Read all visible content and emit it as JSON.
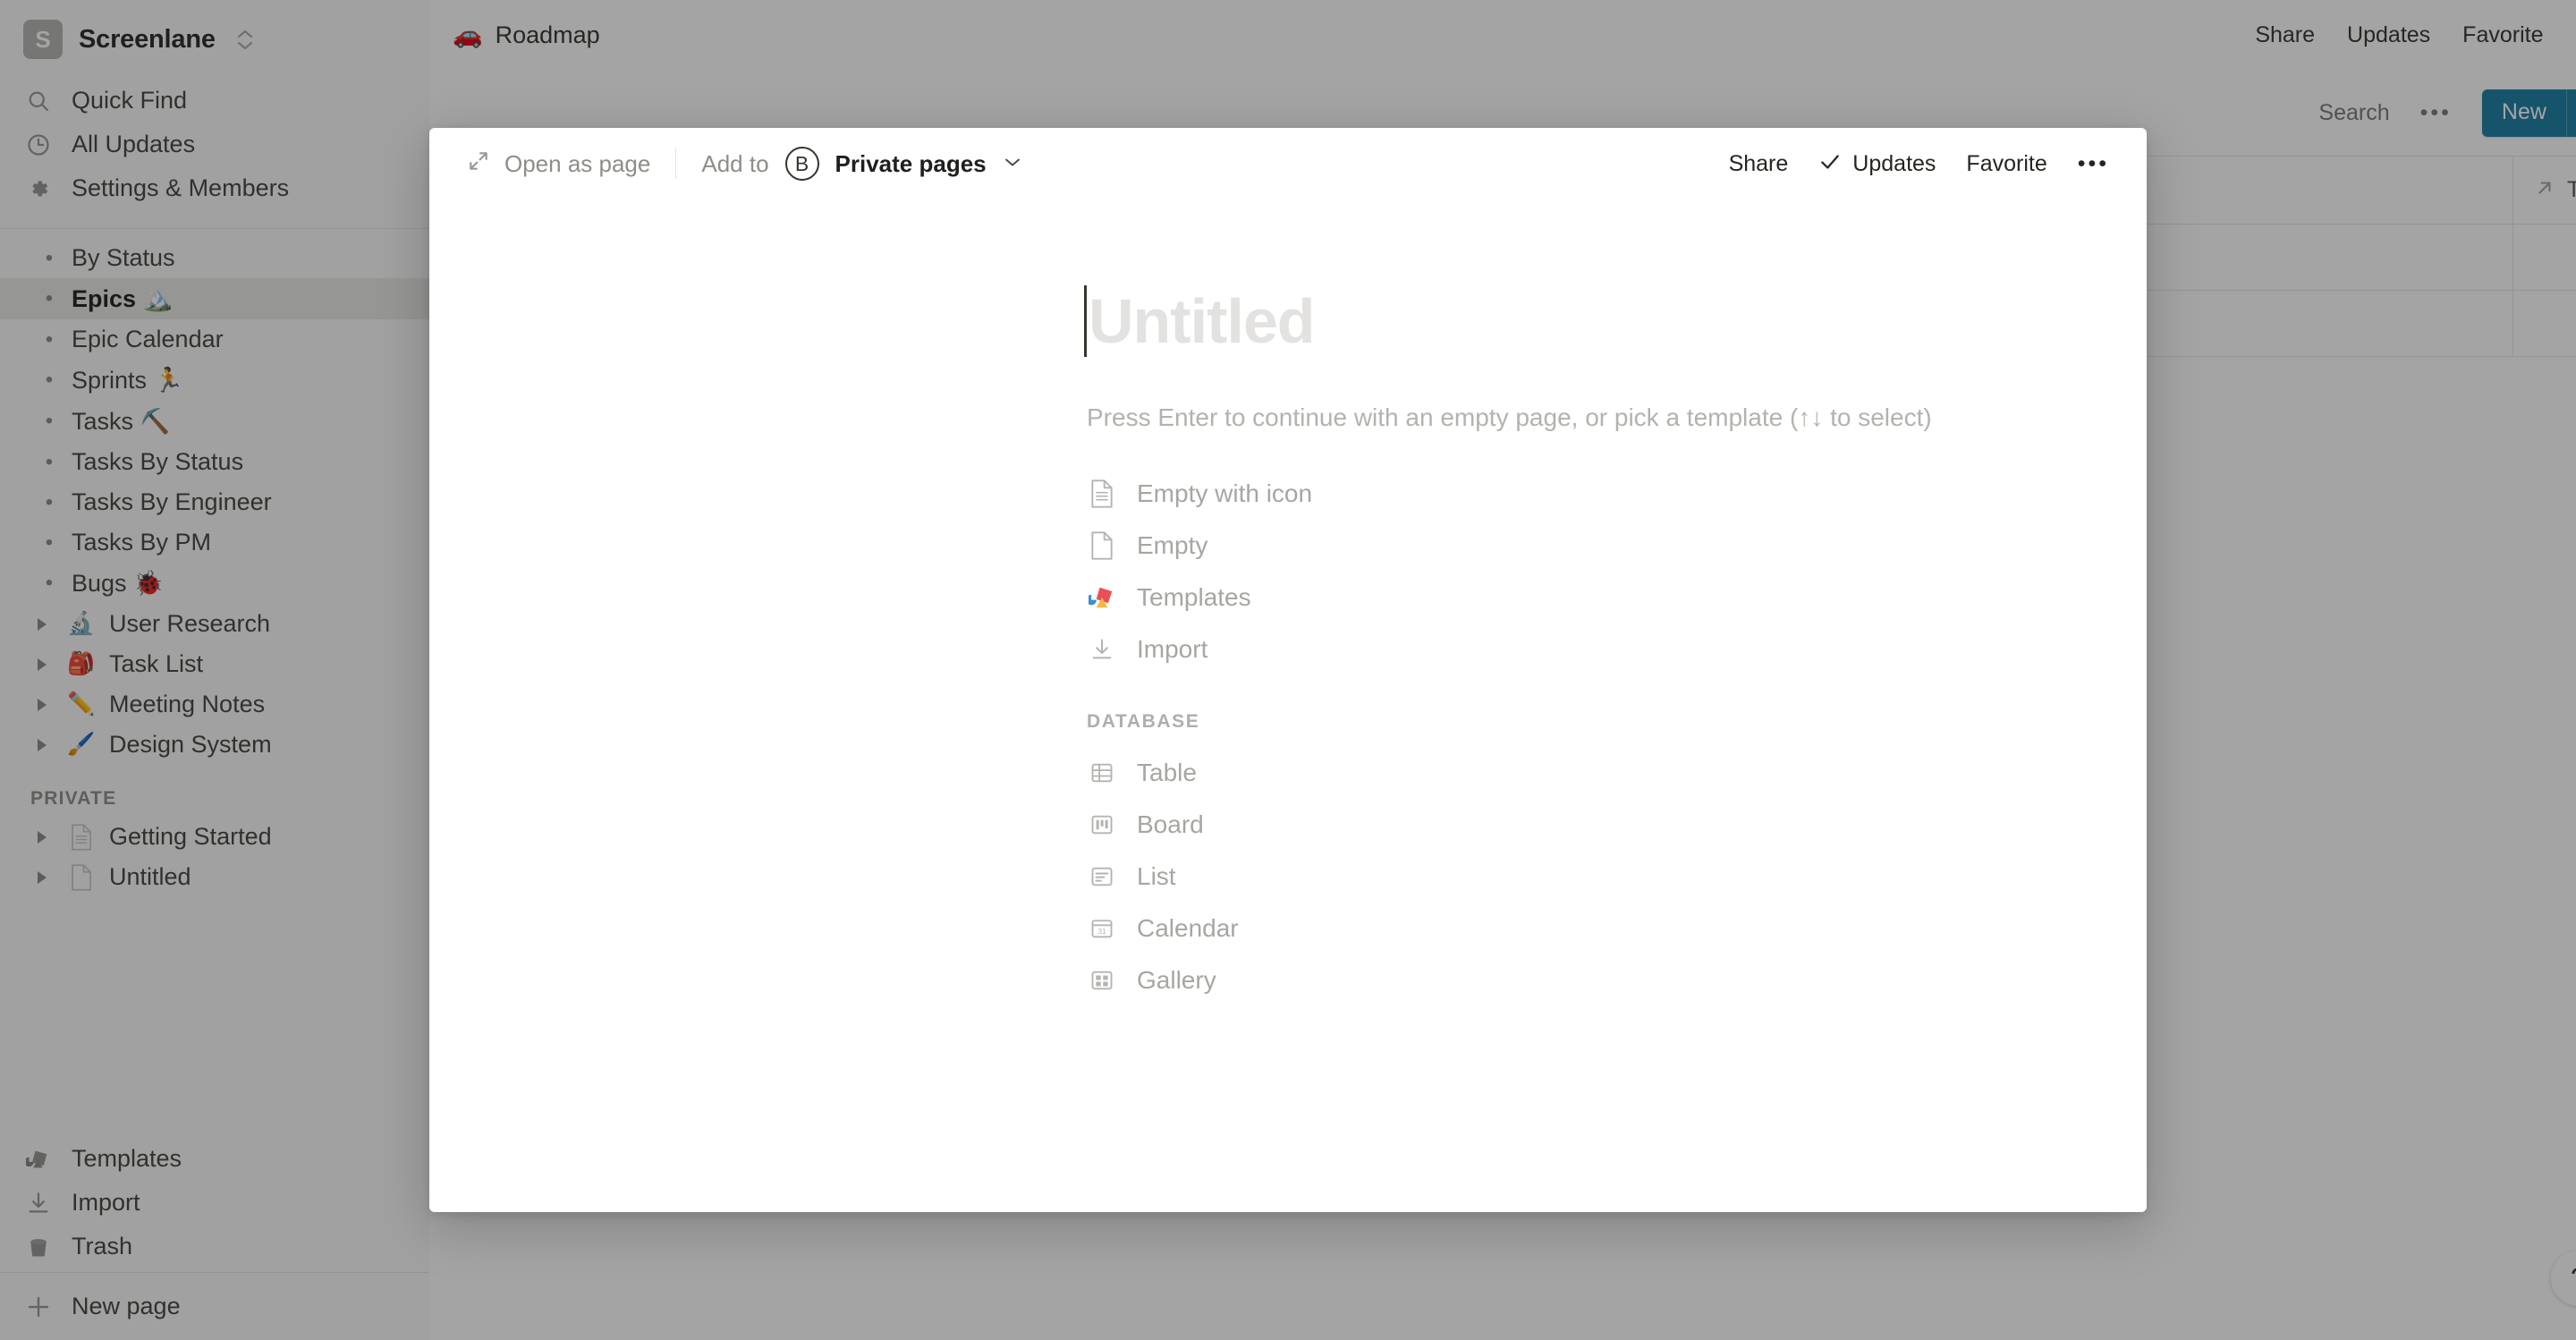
{
  "workspace": {
    "avatar_letter": "S",
    "name": "Screenlane",
    "switch_icon": "chevron-up-down-icon"
  },
  "sidebar": {
    "top_items": [
      {
        "label": "Quick Find",
        "icon": "search-icon"
      },
      {
        "label": "All Updates",
        "icon": "clock-icon"
      },
      {
        "label": "Settings & Members",
        "icon": "gear-icon"
      }
    ],
    "pages": [
      {
        "label": "By Status",
        "kind": "child",
        "emoji": "",
        "active": false
      },
      {
        "label": "Epics 🏔️",
        "kind": "child",
        "emoji": "",
        "active": true
      },
      {
        "label": "Epic Calendar",
        "kind": "child",
        "emoji": "",
        "active": false
      },
      {
        "label": "Sprints 🏃",
        "kind": "child",
        "emoji": "",
        "active": false
      },
      {
        "label": "Tasks ⛏️",
        "kind": "child",
        "emoji": "",
        "active": false
      },
      {
        "label": "Tasks By Status",
        "kind": "child",
        "emoji": "",
        "active": false
      },
      {
        "label": "Tasks By Engineer",
        "kind": "child",
        "emoji": "",
        "active": false
      },
      {
        "label": "Tasks By PM",
        "kind": "child",
        "emoji": "",
        "active": false
      },
      {
        "label": "Bugs 🐞",
        "kind": "child",
        "emoji": "",
        "active": false
      },
      {
        "label": "User Research",
        "kind": "top",
        "emoji": "🔬",
        "active": false
      },
      {
        "label": "Task List",
        "kind": "top",
        "emoji": "🎒",
        "active": false
      },
      {
        "label": "Meeting Notes",
        "kind": "top",
        "emoji": "✏️",
        "active": false
      },
      {
        "label": "Design System",
        "kind": "top",
        "emoji": "🖌️",
        "active": false
      }
    ],
    "private_section_label": "PRIVATE",
    "private_pages": [
      {
        "label": "Getting Started",
        "icon": "document-lines-icon"
      },
      {
        "label": "Untitled",
        "icon": "document-blank-icon"
      }
    ],
    "bottom_items": [
      {
        "label": "Templates",
        "icon": "templates-icon"
      },
      {
        "label": "Import",
        "icon": "import-icon"
      },
      {
        "label": "Trash",
        "icon": "trash-icon"
      }
    ],
    "new_page": {
      "label": "New page",
      "icon": "plus-icon"
    }
  },
  "topbar": {
    "breadcrumb_emoji": "🚗",
    "breadcrumb_title": "Roadmap",
    "actions": [
      "Share",
      "Updates",
      "Favorite"
    ],
    "more_icon": "ellipsis-icon"
  },
  "database_toolbar": {
    "search_label": "Search",
    "more_icon": "ellipsis-icon",
    "new_button_label": "New",
    "new_button_caret_icon": "chevron-down-icon",
    "new_button_color": "#1b7ea3"
  },
  "database_table": {
    "columns": [
      "",
      "",
      "Tasks"
    ],
    "tasks_column_icon": "arrow-up-right-icon",
    "rows": [
      [
        "",
        "",
        ""
      ],
      [
        "",
        "",
        ""
      ]
    ]
  },
  "help_button": {
    "label": "?"
  },
  "modal": {
    "toolbar": {
      "open_as_page_label": "Open as page",
      "open_as_page_icon": "expand-diagonal-icon",
      "add_to_label": "Add to",
      "destination_avatar": "B",
      "destination_label": "Private pages",
      "destination_caret_icon": "chevron-down-icon",
      "share_label": "Share",
      "updates_label": "Updates",
      "updates_icon": "check-icon",
      "favorite_label": "Favorite",
      "more_icon": "ellipsis-icon"
    },
    "title_placeholder": "Untitled",
    "hint": "Press Enter to continue with an empty page, or pick a template (↑↓ to select)",
    "template_options": [
      {
        "label": "Empty with icon",
        "icon": "document-lines-icon"
      },
      {
        "label": "Empty",
        "icon": "document-blank-icon"
      },
      {
        "label": "Templates",
        "icon": "templates-color-icon"
      },
      {
        "label": "Import",
        "icon": "import-icon"
      }
    ],
    "database_section_label": "DATABASE",
    "database_options": [
      {
        "label": "Table",
        "icon": "table-icon"
      },
      {
        "label": "Board",
        "icon": "board-icon"
      },
      {
        "label": "List",
        "icon": "list-icon"
      },
      {
        "label": "Calendar",
        "icon": "calendar-icon"
      },
      {
        "label": "Gallery",
        "icon": "gallery-icon"
      }
    ]
  }
}
